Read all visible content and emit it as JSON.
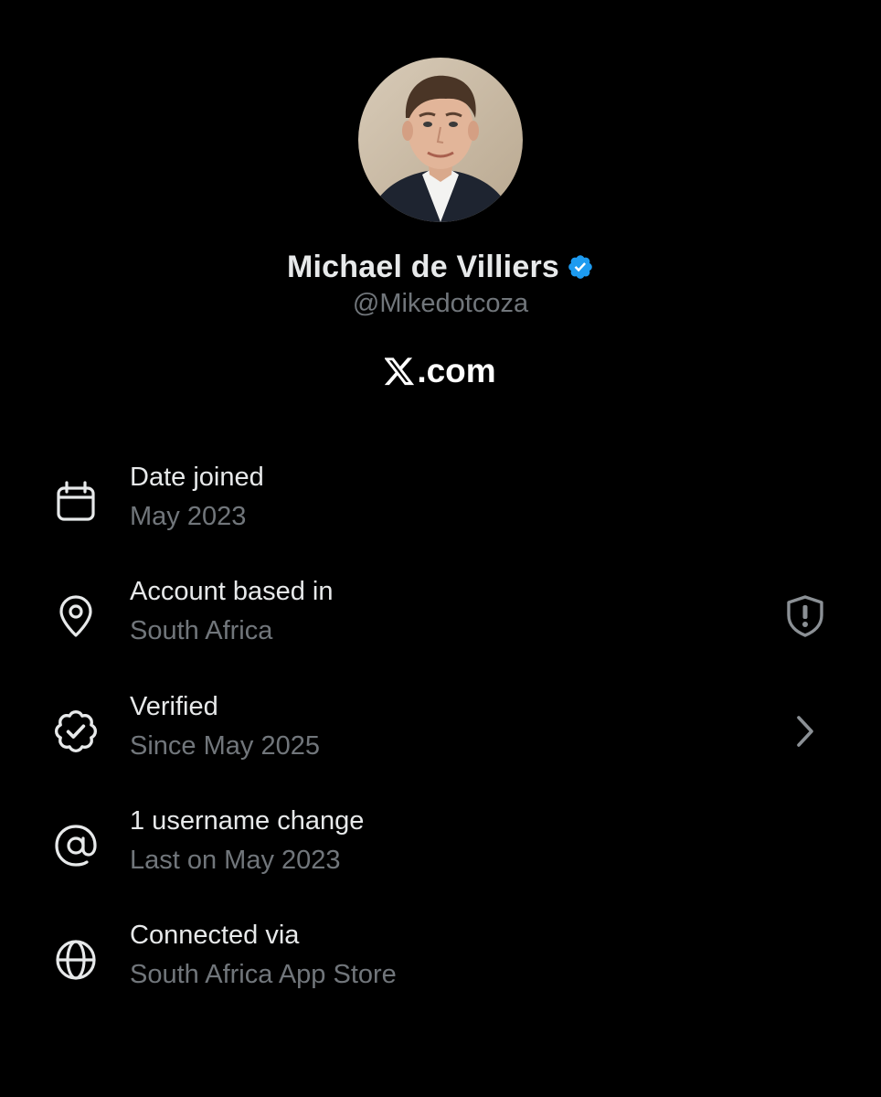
{
  "profile": {
    "display_name": "Michael de Villiers",
    "handle": "@Mikedotcoza",
    "verified": true,
    "verified_color": "#1d9bf0",
    "avatar_icon": "profile-photo"
  },
  "site": {
    "label": ".com",
    "logo": "x-logo"
  },
  "about_rows": [
    {
      "icon": "calendar-icon",
      "title": "Date joined",
      "subtitle": "May 2023"
    },
    {
      "icon": "location-pin-icon",
      "title": "Account based in",
      "subtitle": "South Africa",
      "trailing_icon": "shield-alert-icon"
    },
    {
      "icon": "verified-check-icon",
      "title": "Verified",
      "subtitle": "Since May 2025",
      "trailing_icon": "chevron-right-icon"
    },
    {
      "icon": "at-sign-icon",
      "title": "1 username change",
      "subtitle": "Last on May 2023"
    },
    {
      "icon": "globe-icon",
      "title": "Connected via",
      "subtitle": "South Africa App Store"
    }
  ],
  "colors": {
    "background": "#000000",
    "primary_text": "#e7e9ea",
    "secondary_text": "#71767b",
    "icon": "#e7e9ea"
  }
}
